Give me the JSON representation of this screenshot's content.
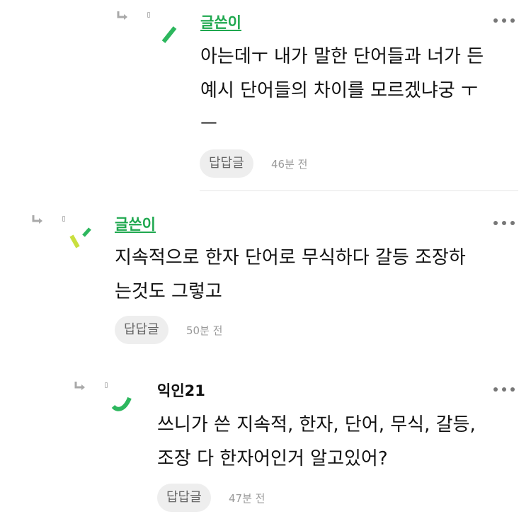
{
  "comments": [
    {
      "author": "글쓴이",
      "lines": [
        "아는데ㅜ 내가 말한 단어들과 너가 든",
        "예시 단어들의 차이를 모르겠냐궁 ㅜ",
        "ㅡ"
      ],
      "reply_label": "답답글",
      "time": "46분 전"
    },
    {
      "author": "글쓴이",
      "lines": [
        "지속적으로 한자 단어로 무식하다 갈등 조장하",
        "는것도 그렇고"
      ],
      "reply_label": "답답글",
      "time": "50분 전"
    },
    {
      "author": "익인21",
      "lines": [
        "쓰니가 쓴 지속적, 한자, 단어, 무식, 갈등,",
        "조장 다 한자어인거 알고있어?"
      ],
      "reply_label": "답답글",
      "time": "47분 전"
    }
  ],
  "icons": {
    "reply_arrow": "reply-arrow-icon",
    "more": "more-options-icon"
  },
  "colors": {
    "author_accent": "#1fa84f",
    "avatar_green": "#2db75e",
    "avatar_lime": "#c9df3e",
    "button_bg": "#eeeeee"
  }
}
